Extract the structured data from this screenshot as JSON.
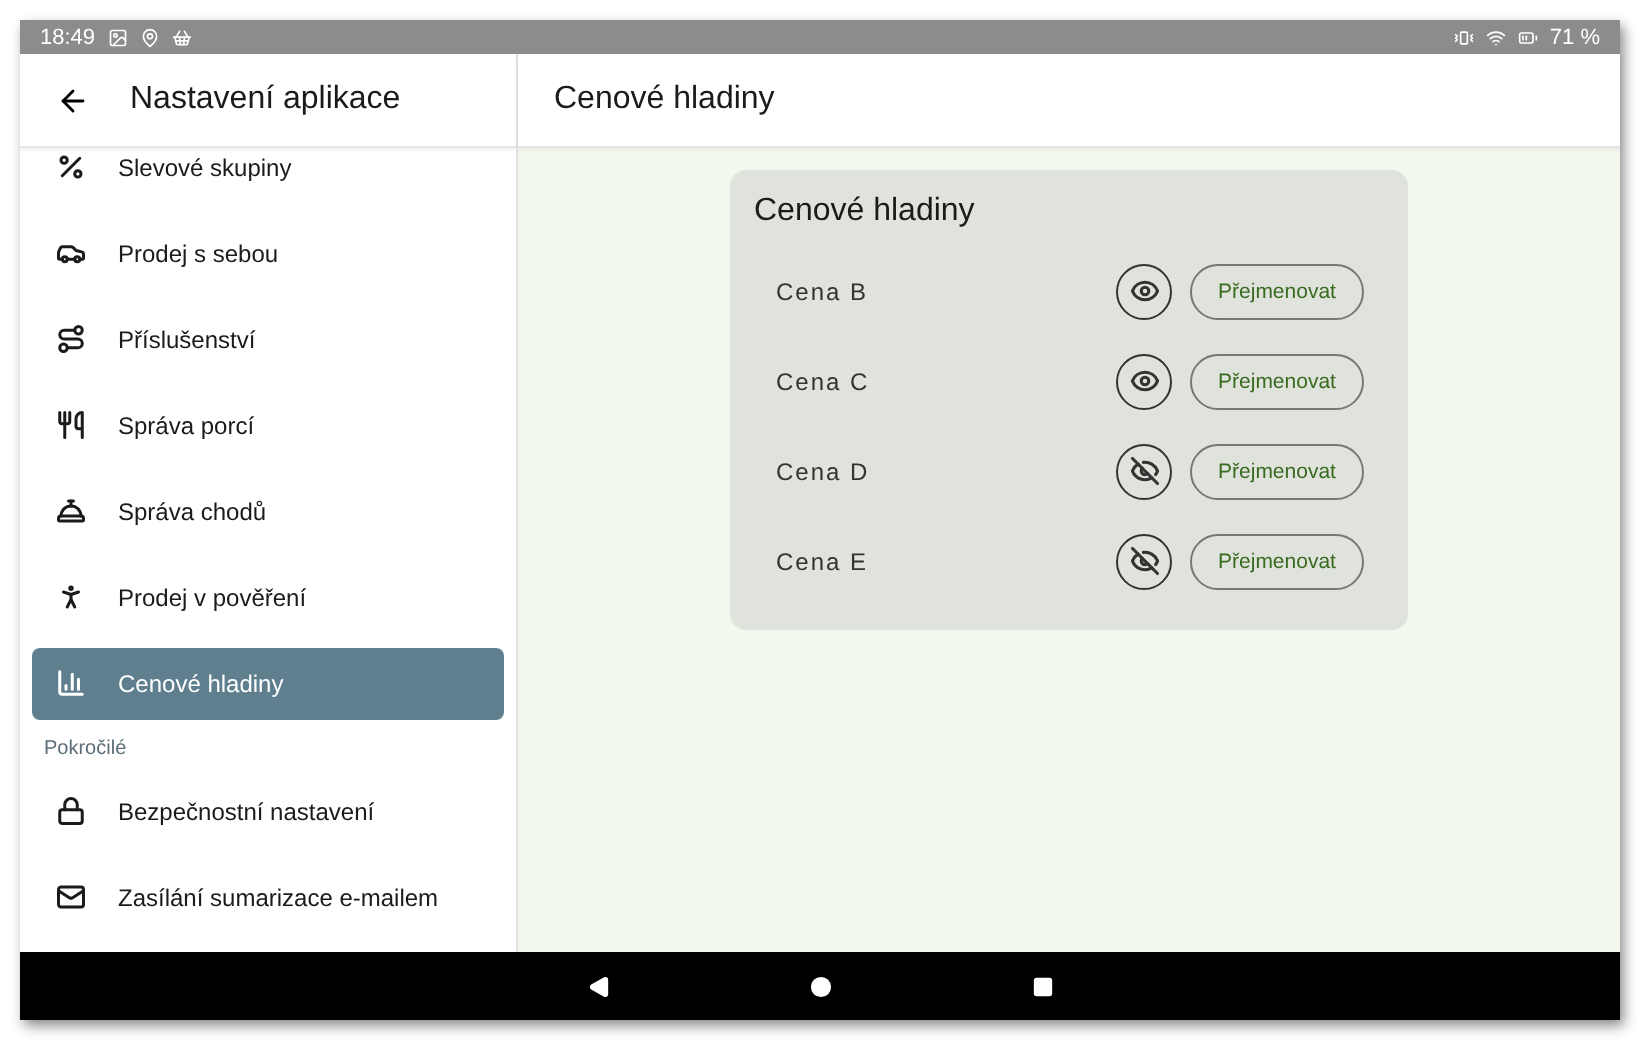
{
  "status_bar": {
    "time": "18:49",
    "battery": "71 %"
  },
  "sidebar": {
    "title": "Nastavení aplikace",
    "items": [
      {
        "label": "Slevové skupiny",
        "selected": false
      },
      {
        "label": "Prodej s sebou",
        "selected": false
      },
      {
        "label": "Příslušenství",
        "selected": false
      },
      {
        "label": "Správa porcí",
        "selected": false
      },
      {
        "label": "Správa chodů",
        "selected": false
      },
      {
        "label": "Prodej v pověření",
        "selected": false
      },
      {
        "label": "Cenové hladiny",
        "selected": true
      }
    ],
    "section": "Pokročilé",
    "advanced_items": [
      {
        "label": "Bezpečnostní nastavení",
        "selected": false
      },
      {
        "label": "Zasílání sumarizace e-mailem",
        "selected": false
      }
    ]
  },
  "page": {
    "title": "Cenové hladiny"
  },
  "card": {
    "title": "Cenové hladiny",
    "rows": [
      {
        "name": "Cena B",
        "visible": true,
        "button": "Přejmenovat"
      },
      {
        "name": "Cena C",
        "visible": true,
        "button": "Přejmenovat"
      },
      {
        "name": "Cena D",
        "visible": false,
        "button": "Přejmenovat"
      },
      {
        "name": "Cena E",
        "visible": false,
        "button": "Přejmenovat"
      }
    ]
  }
}
